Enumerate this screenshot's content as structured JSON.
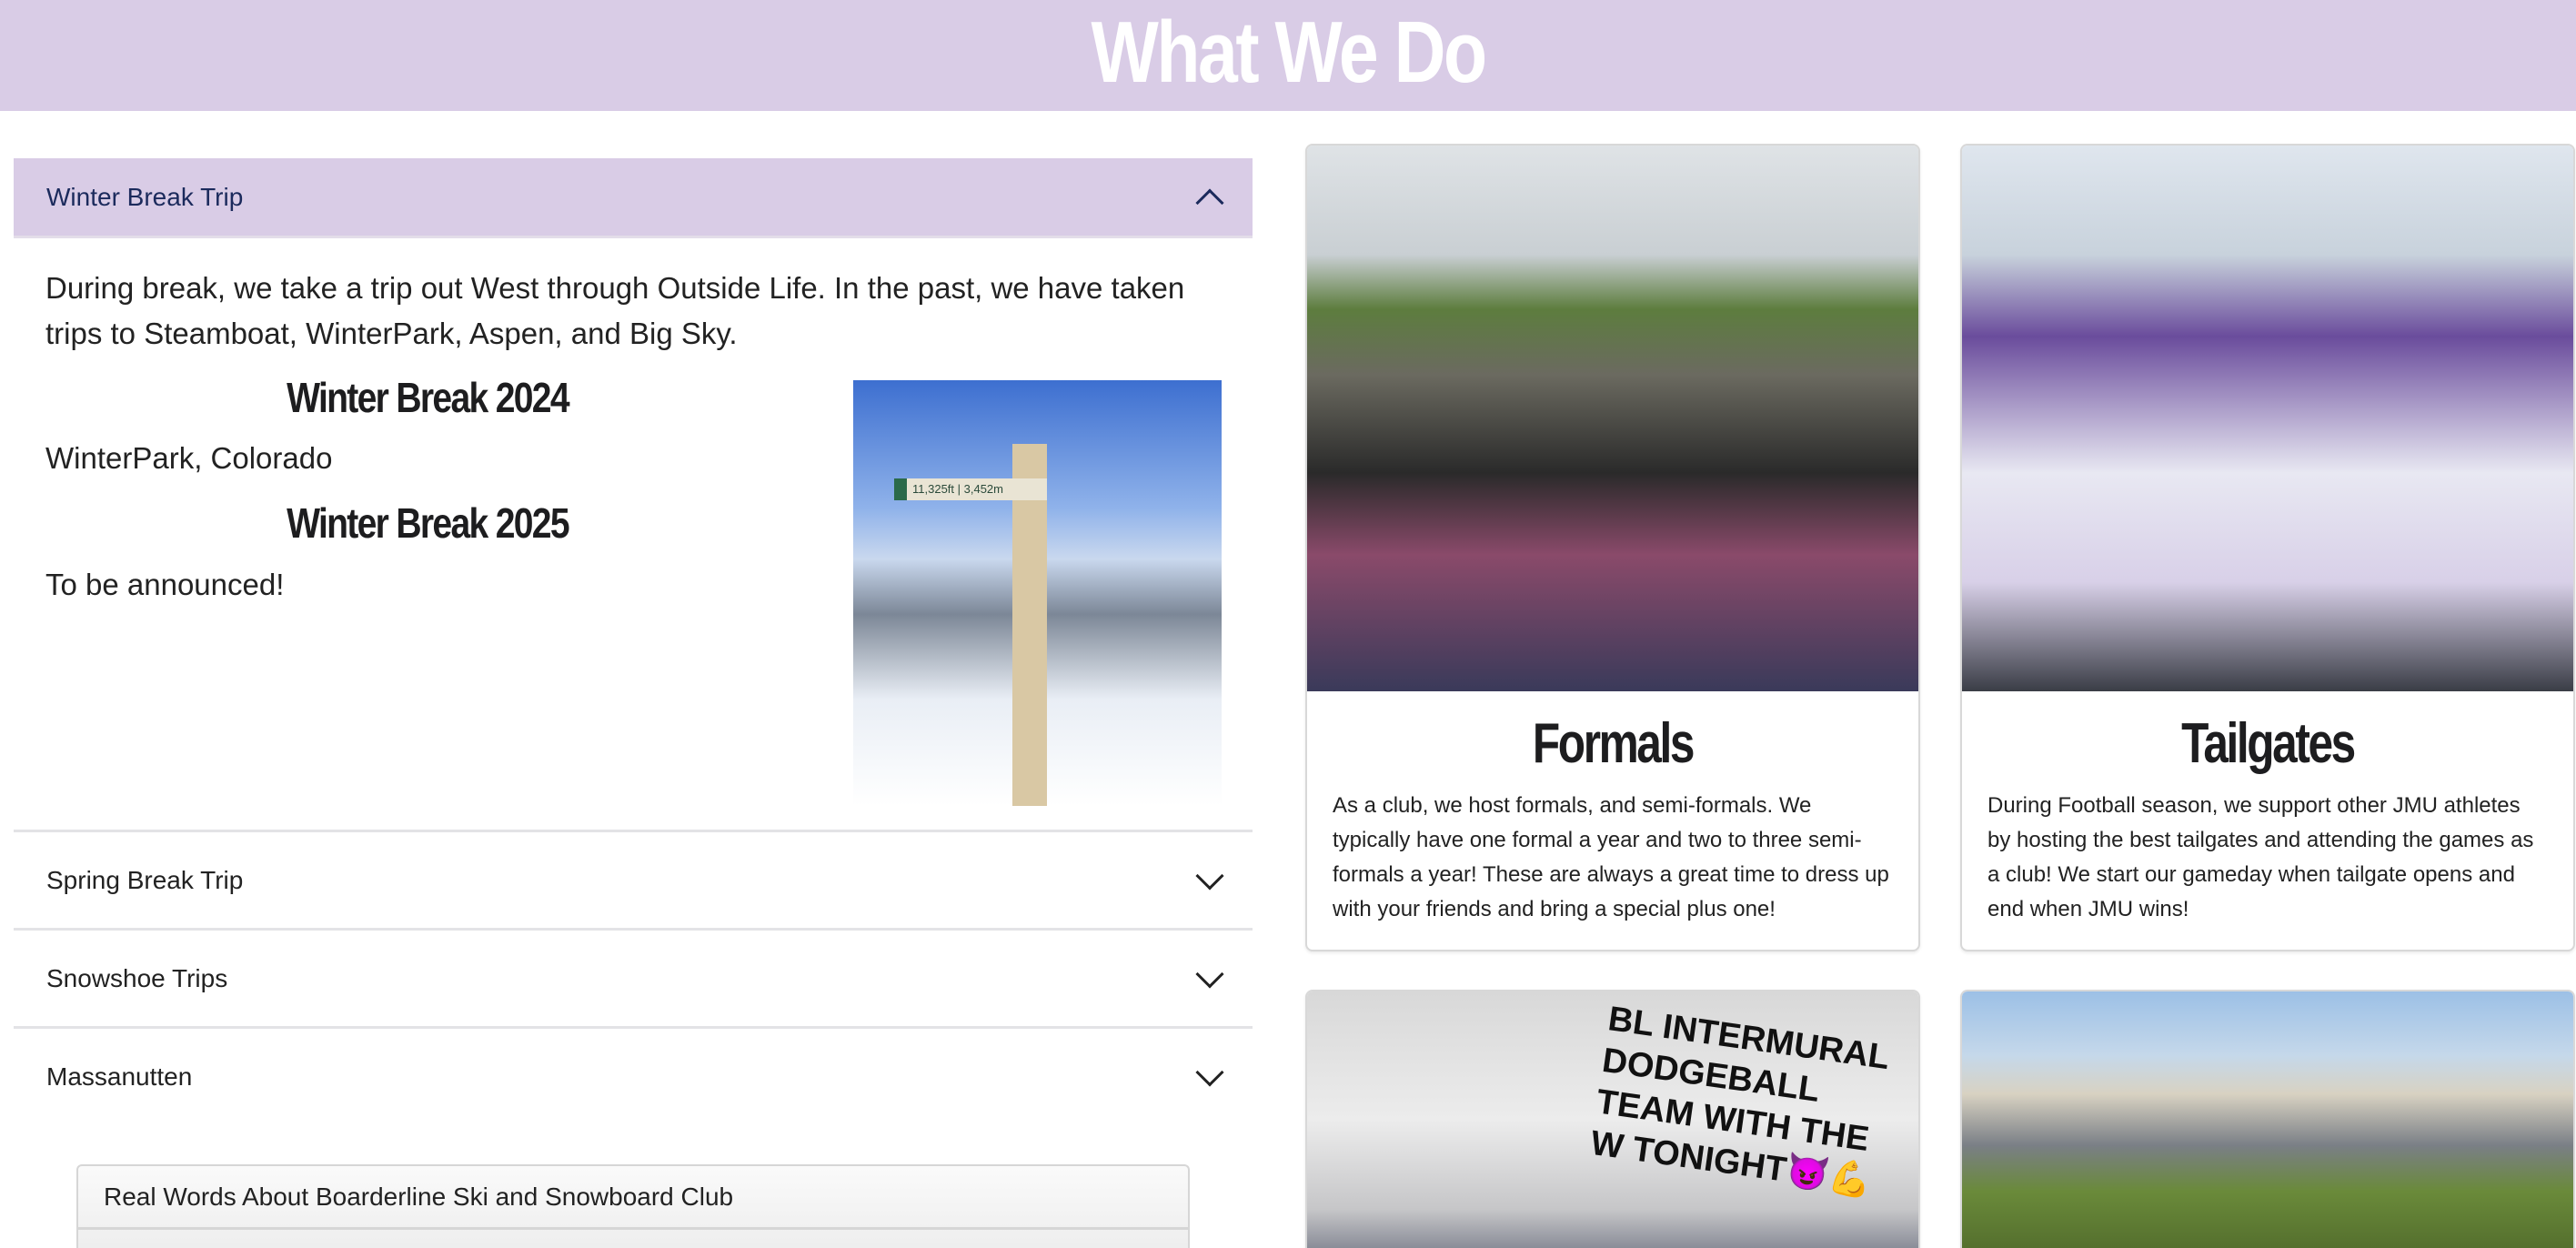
{
  "header": {
    "title": "What We Do"
  },
  "accordion": {
    "open": {
      "label": "Winter Break Trip",
      "description": "During break, we take a trip out West through Outside Life. In the past, we have taken trips to Steamboat, WinterPark, Aspen, and Big Sky.",
      "sections": [
        {
          "heading": "Winter Break 2024",
          "text": "WinterPark, Colorado"
        },
        {
          "heading": "Winter Break 2025",
          "text": "To be announced!"
        }
      ],
      "photo_sign": "11,325ft | 3,452m"
    },
    "items": [
      {
        "label": "Spring Break Trip"
      },
      {
        "label": "Snowshoe Trips"
      },
      {
        "label": "Massanutten"
      }
    ]
  },
  "testimonials": {
    "title": "Real Words About Boarderline Ski and Snowboard Club"
  },
  "cards": [
    {
      "title": "Formals",
      "text": "As a club, we host formals, and semi-formals. We typically have one formal a year and two to three semi-formals a year! These are always a great time to dress up with your friends and bring a special plus one!"
    },
    {
      "title": "Tailgates",
      "text": "During Football season, we support other JMU athletes by hosting the best tailgates and attending the games as a club! We start our gameday when tailgate opens and end when JMU wins!"
    }
  ],
  "photo_caption": "BL INTERMURAL DODGEBALL TEAM WITH THE W TONIGHT😈💪"
}
